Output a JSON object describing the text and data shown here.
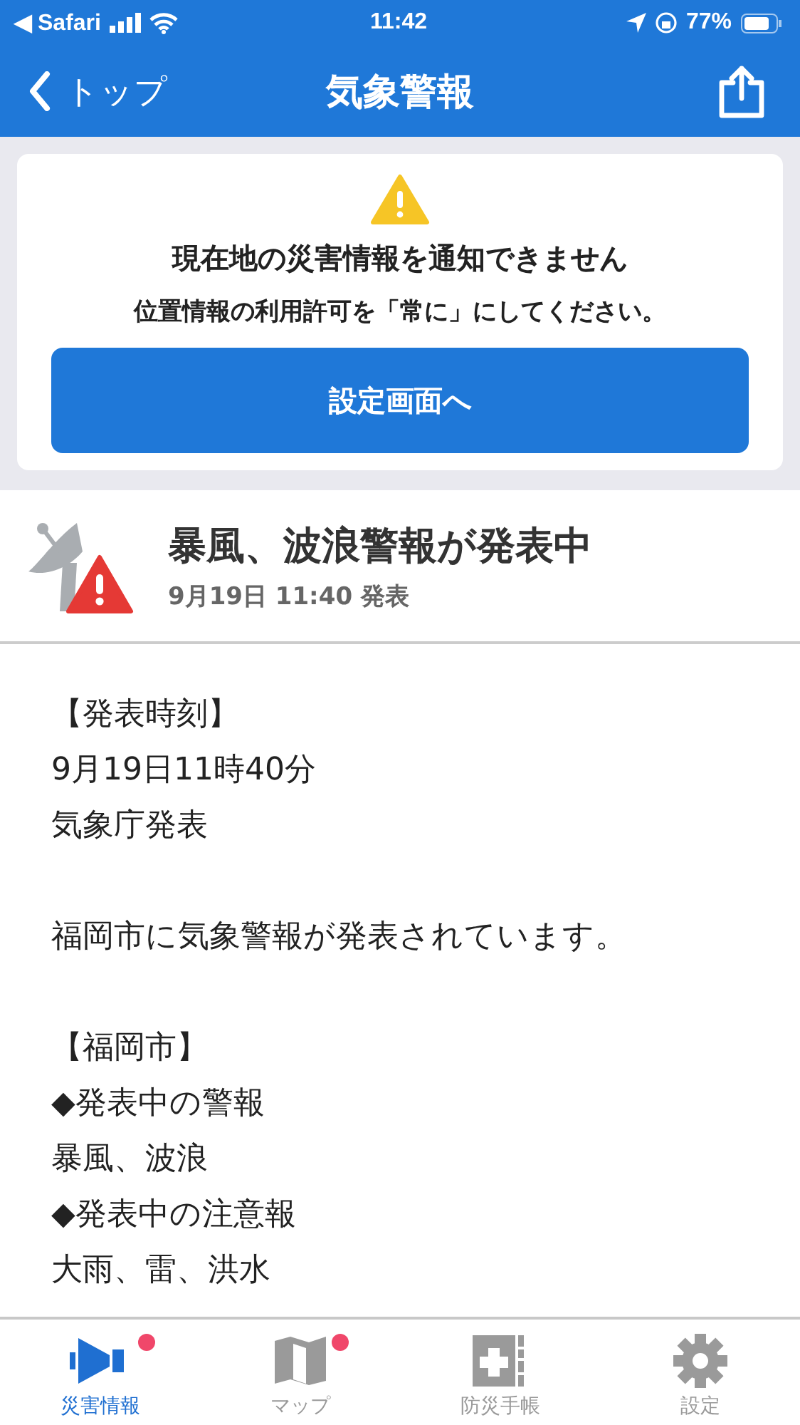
{
  "status_bar": {
    "back_app": "◀ Safari",
    "time": "11:42",
    "battery": "77%"
  },
  "nav": {
    "back": "トップ",
    "title": "気象警報"
  },
  "notice": {
    "title": "現在地の災害情報を通知できません",
    "message": "位置情報の利用許可を「常に」にしてください。",
    "button": "設定画面へ"
  },
  "alert": {
    "title": "暴風、波浪警報が発表中",
    "issued": "9月19日 11:40 発表"
  },
  "body": [
    [
      "【発表時刻】",
      "9月19日11時40分",
      "気象庁発表"
    ],
    [
      "福岡市に気象警報が発表されています。"
    ],
    [
      "【福岡市】",
      "◆発表中の警報",
      "暴風、波浪",
      "◆発表中の注意報",
      "大雨、雷、洪水"
    ]
  ],
  "tabs": [
    {
      "kind": "disaster",
      "label": "災害情報",
      "selected": true,
      "badge": true
    },
    {
      "kind": "map",
      "label": "マップ",
      "selected": false,
      "badge": true
    },
    {
      "kind": "handbook",
      "label": "防災手帳",
      "selected": false,
      "badge": false
    },
    {
      "kind": "settings",
      "label": "設定",
      "selected": false,
      "badge": false
    }
  ]
}
